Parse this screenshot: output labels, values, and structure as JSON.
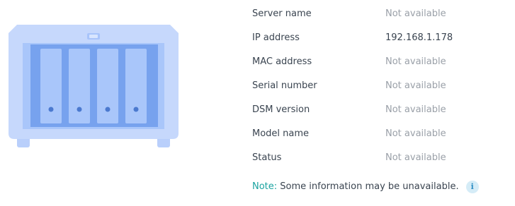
{
  "device_icon": "nas-server-icon",
  "info_rows": [
    {
      "label": "Server name",
      "value": "Not available"
    },
    {
      "label": "IP address",
      "value": "192.168.1.178"
    },
    {
      "label": "MAC address",
      "value": "Not available"
    },
    {
      "label": "Serial number",
      "value": "Not available"
    },
    {
      "label": "DSM version",
      "value": "Not available"
    },
    {
      "label": "Model name",
      "value": "Not available"
    },
    {
      "label": "Status",
      "value": "Not available"
    }
  ],
  "note": {
    "label": "Note:",
    "text": "Some information may be unavailable.",
    "icon": "info-icon"
  },
  "colors": {
    "device_body": "#c6d8fc",
    "device_panel": "#77a2ee",
    "drive_bay": "#a9c6fa",
    "accent": "#1aa3a0",
    "muted_text": "#9aa0a8",
    "label_text": "#3a4450"
  }
}
